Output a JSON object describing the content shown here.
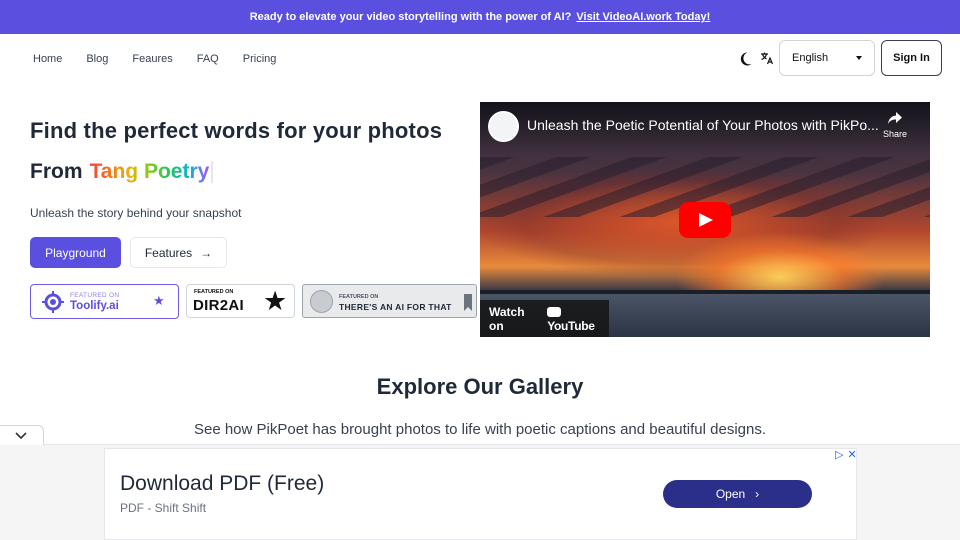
{
  "banner": {
    "text": "Ready to elevate your video storytelling with the power of AI?",
    "link": "Visit VideoAI.work Today!"
  },
  "nav": {
    "links": [
      "Home",
      "Blog",
      "Feaures",
      "FAQ",
      "Pricing"
    ],
    "language": "English",
    "signin": "Sign In"
  },
  "hero": {
    "title": "Find the perfect words for your photos",
    "from": "From",
    "typed": "Tang Poetry",
    "tagline": "Unleash the story behind your snapshot",
    "primary_button": "Playground",
    "secondary_button": "Features",
    "secondary_arrow": "→"
  },
  "badges": {
    "toolify": {
      "small": "FEATURED ON",
      "big": "Toolify.ai",
      "star": "★"
    },
    "dir2ai": {
      "small": "FEATURED ON",
      "big": "DIR2AI",
      "star": "★"
    },
    "taaft": {
      "small": "FEATURED ON",
      "big": "THERE'S AN AI FOR THAT"
    }
  },
  "video": {
    "title": "Unleash the Poetic Potential of Your Photos with PikPo...",
    "share": "Share",
    "watch_on": "Watch on",
    "youtube": "YouTube"
  },
  "gallery": {
    "title": "Explore Our Gallery",
    "subtitle": "See how PikPoet has brought photos to life with poetic captions and beautiful designs."
  },
  "ad": {
    "headline": "Download PDF (Free)",
    "subline": "PDF - Shift Shift",
    "button": "Open",
    "button_chevron": "›",
    "choices_icon": "▷",
    "close_icon": "✕"
  },
  "colors": {
    "accent": "#5b4fe0",
    "ad_button": "#2c2f8a",
    "youtube_red": "#ff0000"
  }
}
